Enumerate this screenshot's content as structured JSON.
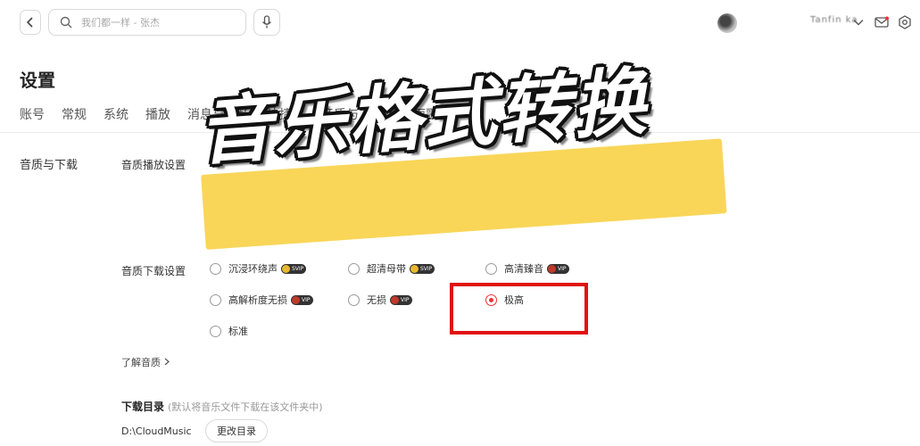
{
  "search": {
    "placeholder": "我们都一样 - 张杰"
  },
  "user": {
    "name": "Tanfin ka"
  },
  "page": {
    "title": "设置"
  },
  "tabs": [
    "账号",
    "常规",
    "系统",
    "播放",
    "消息与隐私",
    "快捷键",
    "音质与下载",
    "桌面歌词"
  ],
  "sections": {
    "quality_download": {
      "title": "音质与下载",
      "playback_label": "音质播放设置",
      "download_label": "音质下载设置",
      "options": [
        {
          "label": "沉浸环绕声",
          "badge": "SVIP",
          "checked": false
        },
        {
          "label": "超清母带",
          "badge": "SVIP",
          "checked": false
        },
        {
          "label": "高清臻音",
          "badge": "VIP",
          "checked": false
        },
        {
          "label": "高解析度无损",
          "badge": "VIP",
          "checked": false
        },
        {
          "label": "无损",
          "badge": "VIP",
          "checked": false
        },
        {
          "label": "极高",
          "badge": "",
          "checked": true
        },
        {
          "label": "标准",
          "badge": "",
          "checked": false
        }
      ],
      "learn_link": "了解音质",
      "download_dir_label": "下载目录",
      "download_dir_note": "(默认将音乐文件下载在该文件夹中)",
      "download_path": "D:\\CloudMusic",
      "change_dir_button": "更改目录"
    }
  },
  "overlay": {
    "title": "音乐格式转换",
    "highlight_color": "#f8d24a",
    "box_color": "#e01010"
  },
  "icons": [
    "chevron-left-icon",
    "search-icon",
    "microphone-icon",
    "chevron-down-icon",
    "mail-icon",
    "settings-icon",
    "chevron-right-icon"
  ]
}
